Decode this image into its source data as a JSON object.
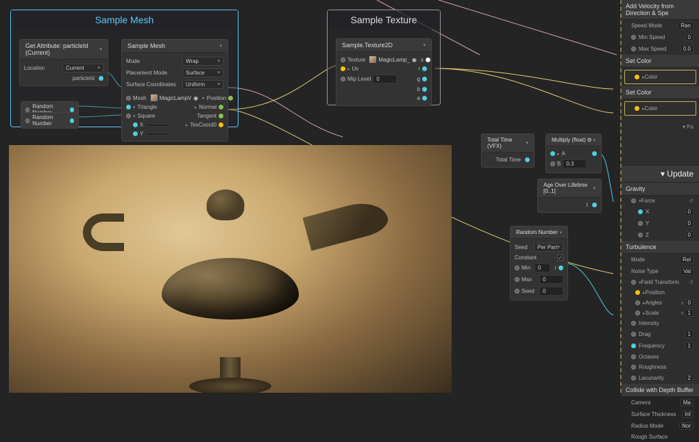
{
  "groups": {
    "sample_mesh": {
      "title": "Sample Mesh"
    },
    "sample_texture": {
      "title": "Sample Texture"
    }
  },
  "get_attr": {
    "header": "Get Attribute: particleId (Current)",
    "location_label": "Location",
    "location_value": "Current",
    "out_label": "particleId"
  },
  "random_small": {
    "label": "Random Number"
  },
  "sample_mesh_node": {
    "header": "Sample Mesh",
    "mode_label": "Mode",
    "mode_value": "Wrap",
    "placement_label": "Placement Mode",
    "placement_value": "Surface",
    "coords_label": "Surface Coordinates",
    "coords_value": "Uniform",
    "mesh_label": "Mesh",
    "mesh_value": "MagicLampV",
    "triangle_label": "Triangle",
    "square_label": "Square",
    "x_label": "X",
    "y_label": "Y",
    "out_position": "Position",
    "out_normal": "Normal",
    "out_tangent": "Tangent",
    "out_texcoord": "TexCoord0"
  },
  "sample_texture_node": {
    "header": "Sample.Texture2D",
    "texture_label": "Texture",
    "texture_value": "MagicLamp_",
    "uv_label": "Uv",
    "mip_label": "Mip Level",
    "mip_value": "0",
    "outs": [
      "s",
      "r",
      "g",
      "b",
      "a"
    ]
  },
  "total_time": {
    "header": "Total Time (VFX)",
    "out_label": "Total Time"
  },
  "multiply": {
    "header": "Multiply (float)",
    "a_label": "A",
    "b_label": "B",
    "b_value": "0.3"
  },
  "age": {
    "header": "Age Over Lifetime [0..1]",
    "out_label": "t"
  },
  "random_number": {
    "header": "Random Number",
    "seed_label": "Seed",
    "seed_value": "Per Part",
    "constant_label": "Constant",
    "min_label": "Min",
    "min_value": "0",
    "max_label": "Max",
    "max_value": "0",
    "seed2_label": "Seed",
    "seed2_value": "0",
    "out_label": "r"
  },
  "panel": {
    "velocity": {
      "header": "Add Velocity from Direction & Spe",
      "speed_mode_label": "Speed Mode",
      "speed_mode_value": "Ran",
      "min_speed_label": "Min Speed",
      "min_speed_value": "0",
      "max_speed_label": "Max Speed",
      "max_speed_value": "0.0"
    },
    "set_color1": {
      "header": "Set Color",
      "color_label": "Color"
    },
    "set_color2": {
      "header": "Set Color",
      "color_label": "Color"
    },
    "pa_label": "Pa",
    "update_header": "Update",
    "gravity": {
      "header": "Gravity",
      "force_label": "Force",
      "x": "X",
      "xv": "0",
      "y": "Y",
      "yv": "0",
      "z": "Z",
      "zv": "0"
    },
    "turbulence": {
      "header": "Turbulence",
      "mode_label": "Mode",
      "mode_value": "Rel",
      "noise_label": "Noise Type",
      "noise_value": "Val",
      "field_label": "Field Transform",
      "position_label": "Position",
      "angles_label": "Angles",
      "scale_label": "Scale",
      "sx": "x",
      "sxv": "0",
      "ss": "s",
      "ssv": "1",
      "intensity_label": "Intensity",
      "drag_label": "Drag",
      "drag_value": "1",
      "frequency_label": "Frequency",
      "frequency_value": "1",
      "octaves_label": "Octaves",
      "roughness_label": "Roughness",
      "lacunarity_label": "Lacunarity",
      "lacunarity_value": "2"
    },
    "collide": {
      "header": "Collide with Depth Buffer",
      "camera_label": "Camera",
      "camera_value": "Ma",
      "thickness_label": "Surface Thickness",
      "thickness_value": "Inf",
      "radius_label": "Radius Mode",
      "radius_value": "Nor",
      "rough_label": "Rough Surface"
    }
  }
}
